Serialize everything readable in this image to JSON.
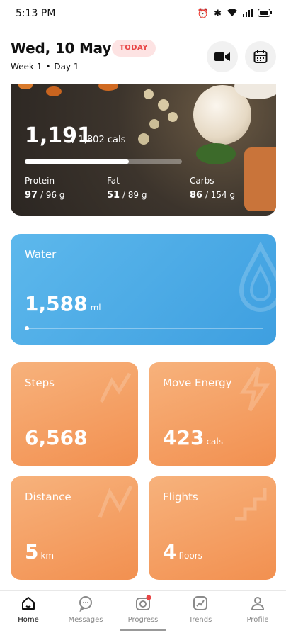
{
  "status": {
    "time": "5:13 PM"
  },
  "header": {
    "date": "Wed, 10 May",
    "badge": "TODAY",
    "week": "Week 1",
    "day": "Day 1"
  },
  "food": {
    "calories": "1,191",
    "goal": "/ 1,802 cals",
    "progress": 0.66,
    "macros": [
      {
        "label": "Protein",
        "value": "97",
        "goal": "/ 96 g"
      },
      {
        "label": "Fat",
        "value": "51",
        "goal": "/ 89 g"
      },
      {
        "label": "Carbs",
        "value": "86",
        "goal": "/ 154 g"
      }
    ]
  },
  "water": {
    "title": "Water",
    "value": "1,588",
    "unit": "ml"
  },
  "stats": [
    {
      "title": "Steps",
      "value": "6,568",
      "unit": ""
    },
    {
      "title": "Move Energy",
      "value": "423",
      "unit": "cals"
    },
    {
      "title": "Distance",
      "value": "5",
      "unit": "km"
    },
    {
      "title": "Flights",
      "value": "4",
      "unit": "floors"
    }
  ],
  "nav": [
    {
      "label": "Home",
      "icon": "home-icon",
      "active": true
    },
    {
      "label": "Messages",
      "icon": "messages-icon",
      "active": false
    },
    {
      "label": "Progress",
      "icon": "progress-camera-icon",
      "active": false
    },
    {
      "label": "Trends",
      "icon": "trends-icon",
      "active": false
    },
    {
      "label": "Profile",
      "icon": "profile-icon",
      "active": false
    }
  ],
  "colors": {
    "water": "#4aa8e6",
    "orange": "#f4a066",
    "badge_text": "#e84545",
    "badge_bg": "#fde3e3",
    "notification_dot": "#e84545"
  }
}
